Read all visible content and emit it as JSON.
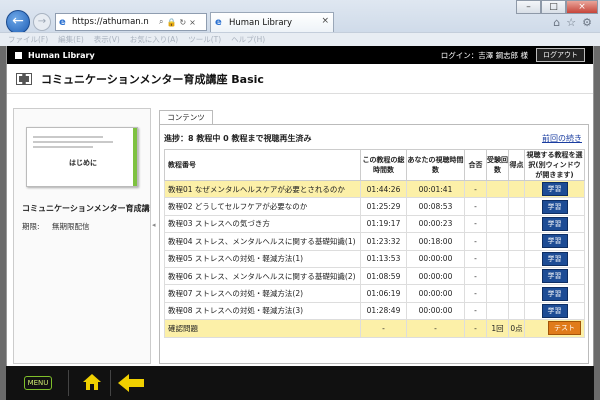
{
  "browser": {
    "address": "https://athuman.n",
    "tab_title": "Human Library",
    "menu": [
      "ファイル(F)",
      "編集(E)",
      "表示(V)",
      "お気に入り(A)",
      "ツール(T)",
      "ヘルプ(H)"
    ]
  },
  "header": {
    "brand": "Human Library",
    "login": "ログイン：吉澤 鋼志郎 様",
    "logout": "ログアウト"
  },
  "course": {
    "title": "コミュニケーションメンター育成講座 Basic",
    "thumb_title": "はじめに",
    "name": "コミュニケーションメンター育成講",
    "limit_label": "期限:",
    "limit_value": "無期限配信"
  },
  "content": {
    "tab": "コンテンツ",
    "progress": "進捗：8 教程中 0 教程まで視聴再生済み",
    "resume": "前回の続き",
    "columns": [
      "教程番号",
      "この教程の総時間数",
      "あなたの視聴時間数",
      "合否",
      "受験回数",
      "得点",
      "視聴する教程を選択(別ウィンドウが開きます)"
    ],
    "rows": [
      {
        "name": "教程01 なぜメンタルヘルスケアが必要とされるのか",
        "total": "01:44:26",
        "watched": "00:01:41",
        "result": "-",
        "btn": "学習"
      },
      {
        "name": "教程02 どうしてセルフケアが必要なのか",
        "total": "01:25:29",
        "watched": "00:08:53",
        "result": "-",
        "btn": "学習"
      },
      {
        "name": "教程03 ストレスへの気づき方",
        "total": "01:19:17",
        "watched": "00:00:23",
        "result": "-",
        "btn": "学習"
      },
      {
        "name": "教程04 ストレス、メンタルヘルスに関する基礎知識(1)",
        "total": "01:23:32",
        "watched": "00:18:00",
        "result": "-",
        "btn": "学習"
      },
      {
        "name": "教程05 ストレスへの対処・軽減方法(1)",
        "total": "01:13:53",
        "watched": "00:00:00",
        "result": "-",
        "btn": "学習"
      },
      {
        "name": "教程06 ストレス、メンタルヘルスに関する基礎知識(2)",
        "total": "01:08:59",
        "watched": "00:00:00",
        "result": "-",
        "btn": "学習"
      },
      {
        "name": "教程07 ストレスへの対処・軽減方法(2)",
        "total": "01:06:19",
        "watched": "00:00:00",
        "result": "-",
        "btn": "学習"
      },
      {
        "name": "教程08 ストレスへの対処・軽減方法(3)",
        "total": "01:28:49",
        "watched": "00:00:00",
        "result": "-",
        "btn": "学習"
      }
    ],
    "footer": {
      "name": "確認問題",
      "total": "-",
      "watched": "-",
      "result": "-",
      "attempts": "1回",
      "score": "0点",
      "btn": "テスト"
    }
  },
  "bottom": {
    "menu": "MENU"
  }
}
